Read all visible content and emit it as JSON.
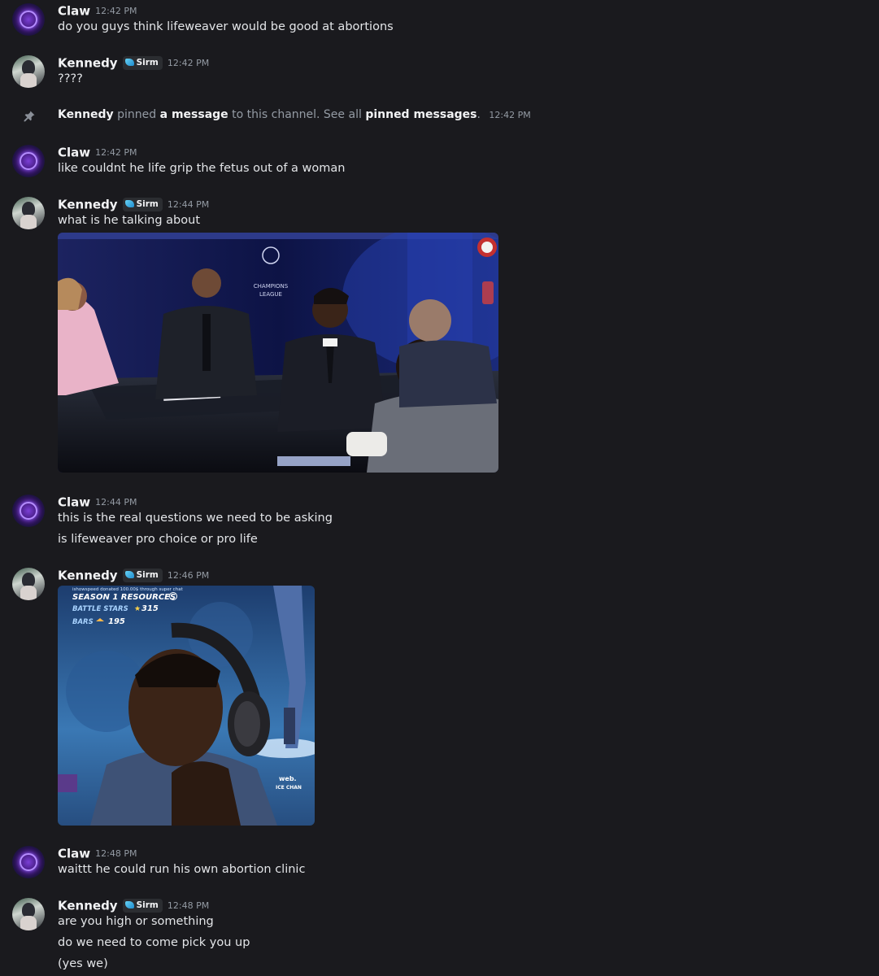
{
  "messages": [
    {
      "author": "Claw",
      "time": "12:42 PM",
      "lines": [
        "do you guys think lifeweaver would be good at abortions"
      ]
    },
    {
      "author": "Kennedy",
      "tag": "Sirm",
      "time": "12:42 PM",
      "lines": [
        "????"
      ]
    },
    {
      "system": {
        "actor": "Kennedy",
        "verb": "pinned",
        "link1": "a message",
        "mid": "to this channel. See all",
        "link2": "pinned messages",
        "end": ".",
        "time": "12:42 PM"
      }
    },
    {
      "author": "Claw",
      "time": "12:42 PM",
      "lines": [
        "like couldnt he life grip the fetus out of a woman"
      ]
    },
    {
      "author": "Kennedy",
      "tag": "Sirm",
      "time": "12:44 PM",
      "lines": [
        "what is he talking about"
      ]
    },
    {
      "author": "Claw",
      "time": "12:44 PM",
      "lines": [
        "this is the real questions we need to be asking",
        "is lifeweaver pro choice or pro life"
      ]
    },
    {
      "author": "Kennedy",
      "tag": "Sirm",
      "time": "12:46 PM",
      "lines": []
    },
    {
      "author": "Claw",
      "time": "12:48 PM",
      "lines": [
        "waittt he could run his own abortion clinic"
      ]
    },
    {
      "author": "Kennedy",
      "tag": "Sirm",
      "time": "12:48 PM",
      "lines": [
        "are you high or something",
        "do we need to come pick you up",
        "(yes we)"
      ]
    }
  ],
  "gif1": {
    "logo_text_1": "CHAMPIONS",
    "logo_text_2": "LEAGUE"
  },
  "gif2": {
    "small_text": "ishowspeed donated 100.00$ through super chat",
    "heading": "SEASON 1 RESOURCES",
    "stars_label": "BATTLE STARS",
    "stars_value": "315",
    "bars_label": "BARS",
    "bars_value": "195",
    "corner_text_1": "web.",
    "corner_text_2": "ICE CHAN"
  },
  "colors": {
    "background": "#1a1a1e",
    "username": "#f2f3f5",
    "timestamp": "#949ba4",
    "tag_accent": "#3fb8ea"
  }
}
